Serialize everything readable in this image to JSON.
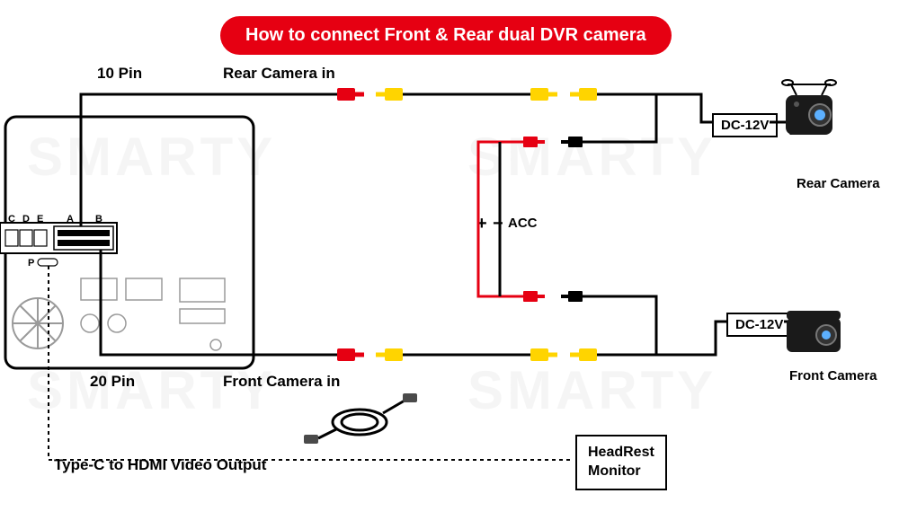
{
  "title": "How to connect Front & Rear dual DVR camera",
  "watermark": "SMARTY",
  "labels": {
    "pin10": "10 Pin",
    "pin20": "20 Pin",
    "rearIn": "Rear Camera in",
    "frontIn": "Front Camera in",
    "typec": "Type-C to HDMI Video Output",
    "acc": "ACC",
    "dc12v_top": "DC-12V",
    "dc12v_bottom": "DC-12V",
    "rearCam": "Rear Camera",
    "frontCam": "Front Camera",
    "headrest1": "HeadRest",
    "headrest2": "Monitor",
    "plus": "+",
    "minus": "−"
  },
  "ports": {
    "c": "C",
    "d": "D",
    "e": "E",
    "a": "A",
    "b": "B",
    "p": "P"
  },
  "colors": {
    "red": "#e60012",
    "yellow": "#ffd400",
    "black": "#000000",
    "grey": "#9a9a9a"
  }
}
